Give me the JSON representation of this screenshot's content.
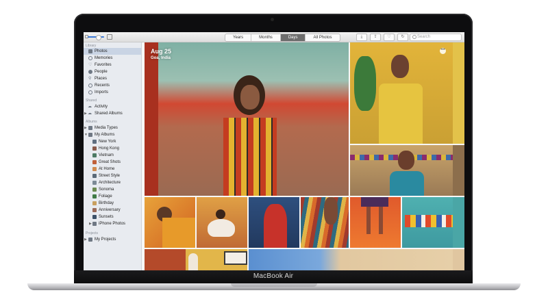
{
  "device": {
    "brand": "MacBook Air"
  },
  "toolbar": {
    "tabs": [
      {
        "label": "Years",
        "active": false
      },
      {
        "label": "Months",
        "active": false
      },
      {
        "label": "Days",
        "active": true
      },
      {
        "label": "All Photos",
        "active": false
      }
    ],
    "search_placeholder": "Search",
    "icons": [
      "import-icon",
      "share-icon",
      "favorite-icon",
      "rotate-icon"
    ]
  },
  "sidebar": {
    "library_heading": "Library",
    "library_items": [
      "Photos",
      "Memories",
      "Favorites",
      "People",
      "Places",
      "Recents",
      "Imports"
    ],
    "selected": "Photos",
    "shared_heading": "Shared",
    "shared_items": [
      "Activity",
      "Shared Albums"
    ],
    "albums_heading": "Albums",
    "albums_items": [
      "Media Types",
      "My Albums"
    ],
    "my_albums": [
      "New York",
      "Hong Kong",
      "Vietnam",
      "Great Shots",
      "At Home",
      "Street Style",
      "Architecture",
      "Sonoma",
      "Foliage",
      "Birthday",
      "Anniversary",
      "Sunsets",
      "iPhone Photos"
    ],
    "projects_heading": "Projects",
    "projects_items": [
      "My Projects"
    ]
  },
  "main": {
    "date": "Aug 25",
    "location": "Goa, India",
    "more_button": "•••"
  },
  "colors": {
    "accent": "#3a78d8",
    "sidebar_bg": "#e8ebf0",
    "sidebar_selected": "#c9d4e4",
    "segment_active": "#6d6d6d"
  }
}
